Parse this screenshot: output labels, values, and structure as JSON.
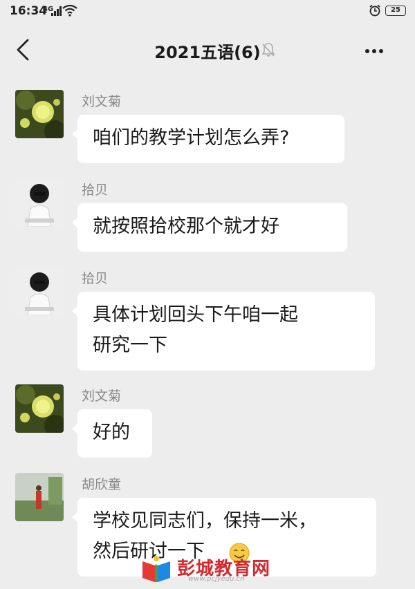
{
  "status_bar": {
    "time": "16:34",
    "network": "4G",
    "battery": "25"
  },
  "header": {
    "title": "2021五语(6)"
  },
  "messages": [
    {
      "sender": "刘文菊",
      "lines": [
        "咱们的教学计划怎么弄?"
      ]
    },
    {
      "sender": "拾贝",
      "lines": [
        "就按照拾校那个就才好"
      ]
    },
    {
      "sender": "拾贝",
      "lines": [
        "具体计划回头下午咱一起",
        "研究一下"
      ]
    },
    {
      "sender": "刘文菊",
      "lines": [
        "好的"
      ]
    },
    {
      "sender": "胡欣童",
      "lines": [
        "学校见同志们，保持一米，",
        "然后研讨一下"
      ]
    }
  ],
  "watermark": {
    "text": "彭城教育网",
    "sub": "www.pcjyedu.cn"
  },
  "colors": {
    "background": "#ededed",
    "bubble": "#ffffff",
    "sender": "#888888",
    "watermark": "#d4282d"
  }
}
